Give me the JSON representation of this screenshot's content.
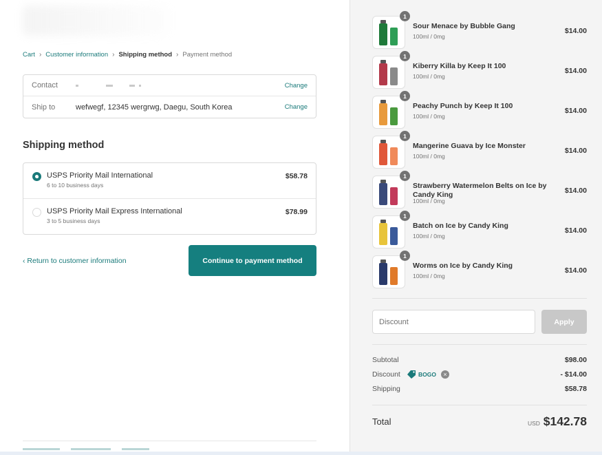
{
  "breadcrumb": {
    "cart": "Cart",
    "customer_information": "Customer information",
    "shipping_method": "Shipping method",
    "payment_method": "Payment method"
  },
  "review": {
    "contact_label": "Contact",
    "contact_value": "",
    "ship_to_label": "Ship to",
    "ship_to_value": "wefwegf, 12345 wergrwg, Daegu, South Korea",
    "change_label": "Change"
  },
  "shipping": {
    "title": "Shipping method",
    "options": [
      {
        "name": "USPS Priority Mail International",
        "days": "6 to 10 business days",
        "price": "$58.78",
        "selected": true
      },
      {
        "name": "USPS Priority Mail Express International",
        "days": "3 to 5 business days",
        "price": "$78.99",
        "selected": false
      }
    ]
  },
  "actions": {
    "return_link": "Return to customer information",
    "continue_button": "Continue to payment method"
  },
  "products": [
    {
      "name": "Sour Menace by Bubble Gang",
      "variant": "100ml / 0mg",
      "price": "$14.00",
      "qty": "1"
    },
    {
      "name": "Kiberry Killa by Keep It 100",
      "variant": "100ml / 0mg",
      "price": "$14.00",
      "qty": "1"
    },
    {
      "name": "Peachy Punch by Keep It 100",
      "variant": "100ml / 0mg",
      "price": "$14.00",
      "qty": "1"
    },
    {
      "name": "Mangerine Guava by Ice Monster",
      "variant": "100ml / 0mg",
      "price": "$14.00",
      "qty": "1"
    },
    {
      "name": "Strawberry Watermelon Belts on Ice by Candy King",
      "variant": "100ml / 0mg",
      "price": "$14.00",
      "qty": "1"
    },
    {
      "name": "Batch on Ice by Candy King",
      "variant": "100ml / 0mg",
      "price": "$14.00",
      "qty": "1"
    },
    {
      "name": "Worms on Ice by Candy King",
      "variant": "100ml / 0mg",
      "price": "$14.00",
      "qty": "1"
    }
  ],
  "discount": {
    "placeholder": "Discount",
    "apply_label": "Apply"
  },
  "summary": {
    "subtotal_label": "Subtotal",
    "subtotal_value": "$98.00",
    "discount_label": "Discount",
    "discount_code": "BOGO",
    "discount_value": "- $14.00",
    "shipping_label": "Shipping",
    "shipping_value": "$58.78",
    "total_label": "Total",
    "currency": "USD",
    "total_value": "$142.78"
  },
  "colors": {
    "accent": "#1a7a7a",
    "button": "#157f7f",
    "sidebar_bg": "#f4f4f4"
  }
}
